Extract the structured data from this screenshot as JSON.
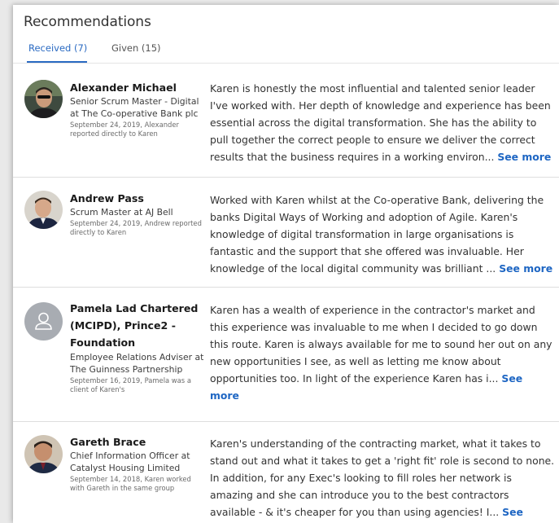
{
  "section_title": "Recommendations",
  "tabs": [
    {
      "label": "Received (7)",
      "active": true
    },
    {
      "label": "Given (15)",
      "active": false
    }
  ],
  "see_more_label": "See more",
  "recommendations": [
    {
      "name": "Alexander Michael",
      "role": "Senior Scrum Master - Digital at The Co-operative Bank plc",
      "relation": "September 24, 2019, Alexander reported directly to Karen",
      "text": "Karen is honestly the most influential and talented senior leader I've worked with. Her depth of knowledge and experience has been essential across the digital transformation. She has the ability to pull together the correct people to ensure we deliver the correct results that the business requires in a working environ...",
      "avatar": "photo"
    },
    {
      "name": "Andrew Pass",
      "role": "Scrum Master at AJ Bell",
      "relation": "September 24, 2019, Andrew reported directly to Karen",
      "text": "Worked with Karen whilst at the Co-operative Bank, delivering the banks Digital Ways of Working and adoption of Agile. Karen's knowledge of digital transformation in large organisations is fantastic and the support that she offered was invaluable. Her knowledge of the local digital community was brilliant ...",
      "avatar": "photo"
    },
    {
      "name": "Pamela Lad Chartered (MCIPD), Prince2 - Foundation",
      "role": "Employee Relations Adviser at The Guinness Partnership",
      "relation": "September 16, 2019, Pamela was a client of Karen's",
      "text": "Karen has a wealth of experience in the contractor's market and this experience was invaluable to me when I decided to go down this route. Karen is always available for me to sound her out on any new opportunities I see, as well as letting me know about opportunities too. In light of the experience Karen has i...",
      "avatar": "placeholder"
    },
    {
      "name": "Gareth Brace",
      "role": "Chief Information Officer at Catalyst Housing Limited",
      "relation": "September 14, 2018, Karen worked with Gareth in the same group",
      "text": "Karen's understanding of the contracting market, what it takes to stand out and what it takes to get a 'right fit' role is second to none. In addition, for any Exec's looking to fill roles her network is amazing and she can introduce you to the best contractors available - & it's cheaper for you than using agencies! I...",
      "avatar": "photo"
    }
  ],
  "colors": {
    "link": "#1e66c3",
    "tab_active": "#2a6ac2"
  }
}
